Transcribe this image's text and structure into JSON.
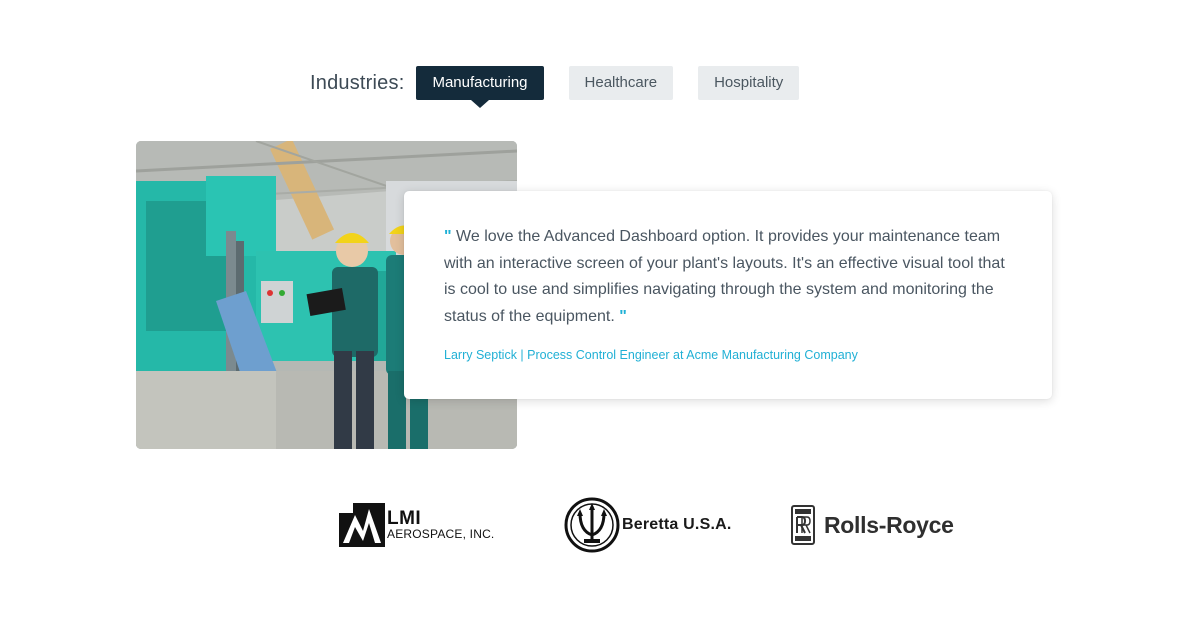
{
  "industries": {
    "label": "Industries:",
    "tabs": [
      {
        "label": "Manufacturing",
        "active": true
      },
      {
        "label": "Healthcare",
        "active": false
      },
      {
        "label": "Hospitality",
        "active": false
      }
    ]
  },
  "testimonial": {
    "open_quote": "\"",
    "quote": " We love the Advanced Dashboard option. It provides your maintenance team with an interactive screen of your plant's layouts. It's an effective visual tool that is cool to use and simplifies navigating through the system and monitoring the status of the equipment. ",
    "close_quote": "\"",
    "author": "Larry Septick | Process Control Engineer at Acme Manufacturing Company"
  },
  "logos": {
    "lmi": {
      "name": "LMI",
      "subtitle": "AEROSPACE, INC."
    },
    "beretta": {
      "name": "Beretta U.S.A."
    },
    "rolls_royce": {
      "name": "Rolls-Royce"
    }
  },
  "colors": {
    "active_tab": "#142b3b",
    "inactive_tab": "#e9ecee",
    "accent": "#1fb1d6"
  }
}
